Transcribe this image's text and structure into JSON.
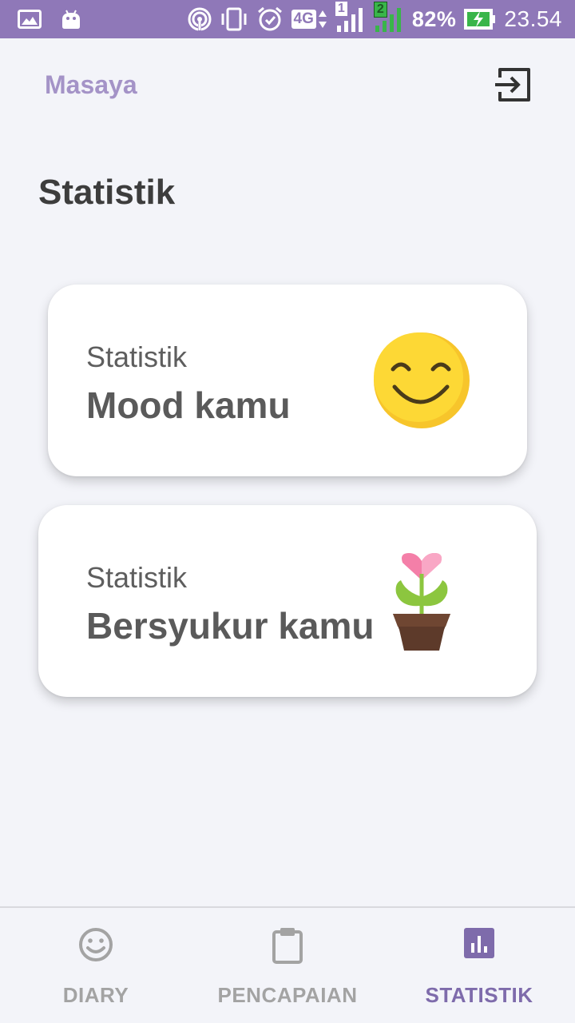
{
  "status_bar": {
    "network": "4G",
    "sim1": "1",
    "sim2": "2",
    "battery": "82%",
    "time": "23.54",
    "icons": [
      "gallery-icon",
      "android-icon",
      "hotspot-icon",
      "vibrate-icon",
      "alarm-icon",
      "network-4g-icon",
      "signal-sim1-icon",
      "signal-sim2-icon",
      "battery-charging-icon"
    ]
  },
  "header": {
    "app_title": "Masaya",
    "logout_icon": "exit-icon"
  },
  "page": {
    "title": "Statistik"
  },
  "cards": [
    {
      "subtitle": "Statistik",
      "title": "Mood kamu",
      "icon": "smiley-face-icon"
    },
    {
      "subtitle": "Statistik",
      "title": "Bersyukur kamu",
      "icon": "heart-flower-pot-icon"
    }
  ],
  "bottom_nav": {
    "items": [
      {
        "label": "DIARY",
        "icon": "smiley-icon",
        "active": false
      },
      {
        "label": "PENCAPAIAN",
        "icon": "clipboard-icon",
        "active": false
      },
      {
        "label": "STATISTIK",
        "icon": "bar-chart-icon",
        "active": true
      }
    ]
  },
  "colors": {
    "status_bar": "#8f78b8",
    "app_title": "#a493c7",
    "accent": "#7e6bab",
    "background": "#f3f4f9",
    "smiley": "#fdd835",
    "flower": "#f47fa8",
    "leaf": "#8cc63f",
    "pot": "#5d3a2a"
  }
}
